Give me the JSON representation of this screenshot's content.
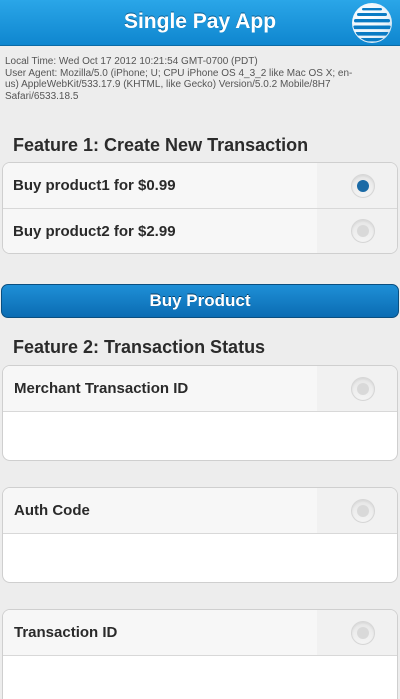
{
  "header": {
    "title": "Single Pay App",
    "logo_icon": "att-globe-icon"
  },
  "info": {
    "local_time": "Local Time: Wed Oct 17 2012 10:21:54 GMT-0700 (PDT)",
    "user_agent_lines": [
      "User Agent: Mozilla/5.0 (iPhone; U; CPU iPhone OS 4_3_2 like Mac OS X; en-",
      "us) AppleWebKit/533.17.9 (KHTML, like Gecko) Version/5.0.2 Mobile/8H7",
      "Safari/6533.18.5"
    ]
  },
  "feature1": {
    "title": "Feature 1: Create New Transaction",
    "options": [
      {
        "label": "Buy product1 for $0.99",
        "checked": true
      },
      {
        "label": "Buy product2 for $2.99",
        "checked": false
      }
    ]
  },
  "buy_button": {
    "label": "Buy Product"
  },
  "feature2": {
    "title": "Feature 2: Transaction Status",
    "fields": [
      {
        "label": "Merchant Transaction ID",
        "value": ""
      },
      {
        "label": "Auth Code",
        "value": ""
      },
      {
        "label": "Transaction ID",
        "value": ""
      }
    ]
  },
  "colors": {
    "header": "#1c97dd",
    "button": "#0b6cb3",
    "radio_checked": "#1a6aa6"
  }
}
